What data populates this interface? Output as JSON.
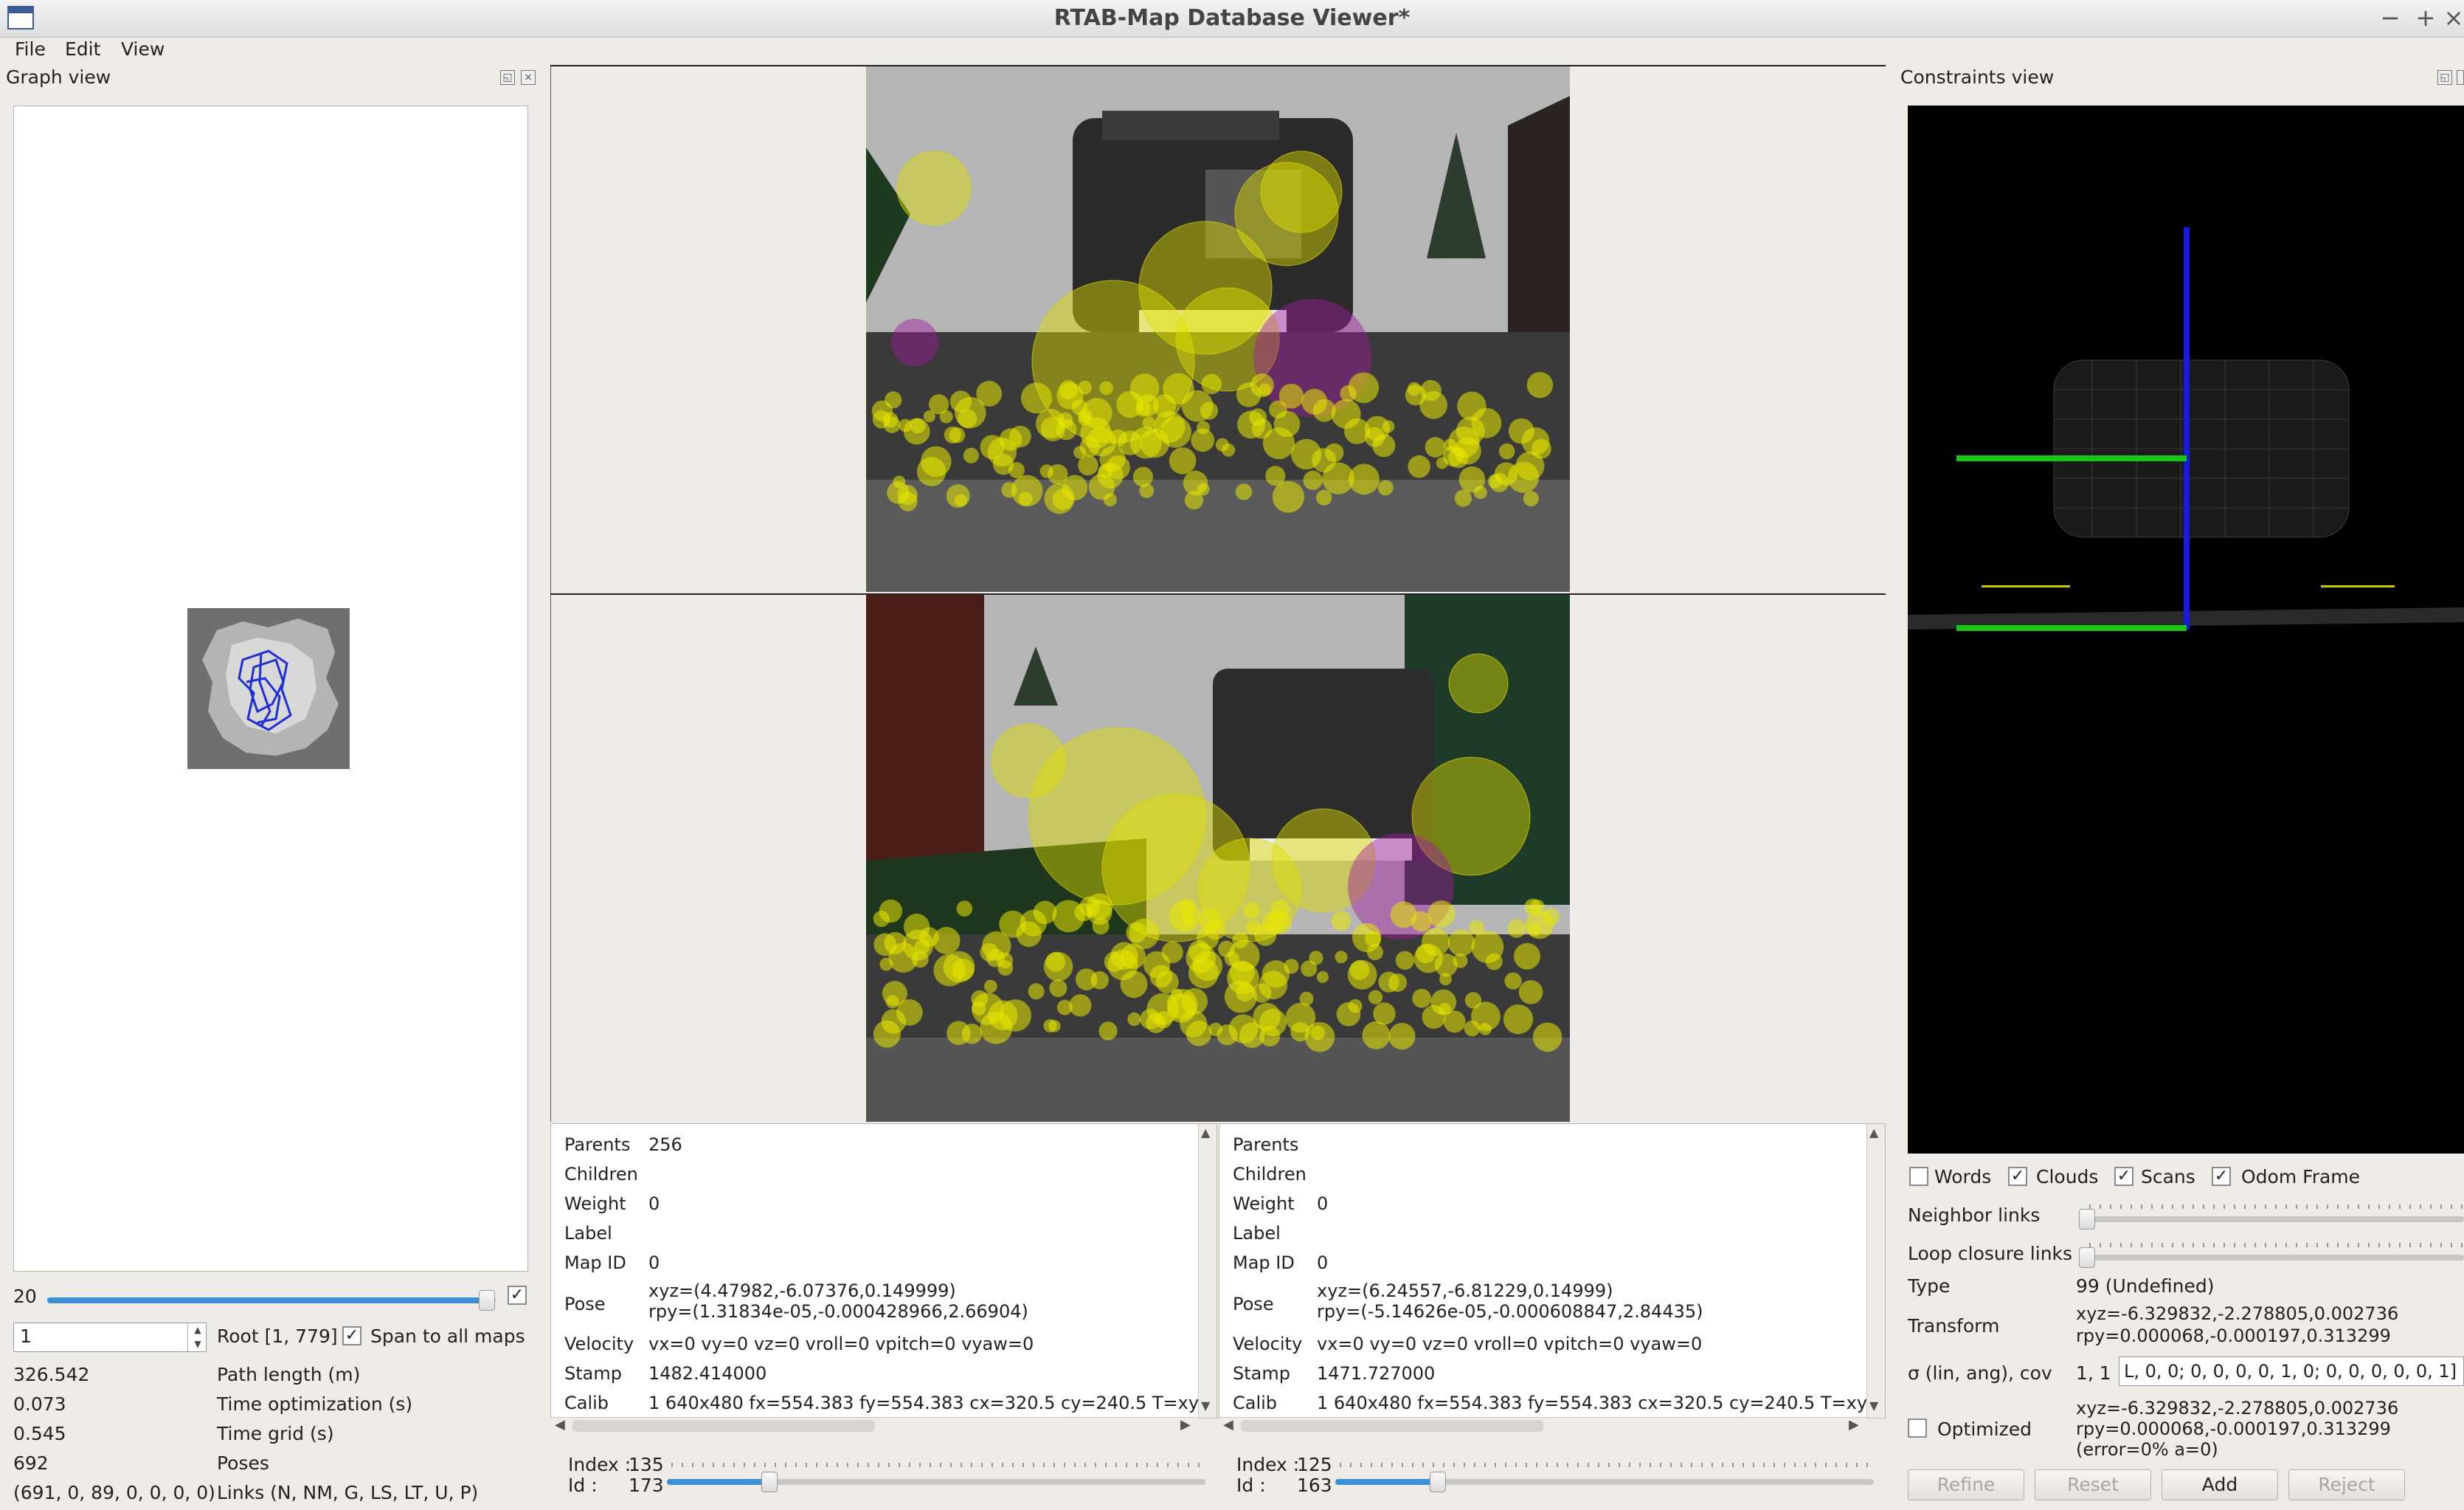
{
  "window": {
    "title": "RTAB-Map Database Viewer*",
    "controls": [
      "−",
      "+",
      "×"
    ]
  },
  "menu": [
    "File",
    "Edit",
    "View"
  ],
  "graph_view": {
    "title": "Graph view",
    "slider_value": "20",
    "slider_fill": 0.98,
    "spin_value": "1",
    "root_label": "Root [1, 779]",
    "span_label": "Span to all maps",
    "span_checked": true,
    "stats": [
      {
        "value": "326.542",
        "label": "Path length (m)"
      },
      {
        "value": "0.073",
        "label": "Time optimization (s)"
      },
      {
        "value": "0.545",
        "label": "Time grid (s)"
      },
      {
        "value": "692",
        "label": "Poses"
      },
      {
        "value": "(691, 0, 89, 0, 0, 0, 0)",
        "label": "Links (N, NM, G, LS, LT, U, P)"
      }
    ]
  },
  "node_a": {
    "parents": "256",
    "children": "",
    "weight": "0",
    "label": "",
    "map_id": "0",
    "pose_xyz": "xyz=(4.47982,-6.07376,0.149999)",
    "pose_rpy": "rpy=(1.31834e-05,-0.000428966,2.66904)",
    "velocity": "vx=0 vy=0 vz=0 vroll=0 vpitch=0 vyaw=0",
    "stamp": "1482.414000",
    "calib": "1 640x480 fx=554.383 fy=554.383 cx=320.5 cy=240.5 T=xy",
    "index": "135",
    "id": "173",
    "slider_fill": 0.19
  },
  "node_b": {
    "parents": "",
    "children": "",
    "weight": "0",
    "label": "",
    "map_id": "0",
    "pose_xyz": "xyz=(6.24557,-6.81229,0.14999)",
    "pose_rpy": "rpy=(-5.14626e-05,-0.000608847,2.84435)",
    "velocity": "vx=0 vy=0 vz=0 vroll=0 vpitch=0 vyaw=0",
    "stamp": "1471.727000",
    "calib": "1 640x480 fx=554.383 fy=554.383 cx=320.5 cy=240.5 T=xy",
    "index": "125",
    "id": "163",
    "slider_fill": 0.19
  },
  "field_labels": {
    "parents": "Parents",
    "children": "Children",
    "weight": "Weight",
    "label": "Label",
    "map_id": "Map ID",
    "pose": "Pose",
    "velocity": "Velocity",
    "stamp": "Stamp",
    "calib": "Calib",
    "index": "Index :",
    "id": "Id :"
  },
  "constraints_view": {
    "title": "Constraints view",
    "checks": [
      {
        "label": "Words",
        "checked": false
      },
      {
        "label": "Clouds",
        "checked": true
      },
      {
        "label": "Scans",
        "checked": true
      },
      {
        "label": "Odom Frame",
        "checked": true
      }
    ],
    "neighbor_links_label": "Neighbor links",
    "loop_closure_links_label": "Loop closure links",
    "type_label": "Type",
    "type_value": "99 (Undefined)",
    "transform_label": "Transform",
    "transform_xyz": "xyz=-6.329832,-2.278805,0.002736",
    "transform_rpy": "rpy=0.000068,-0.000197,0.313299",
    "sigma_label": "σ (lin, ang), cov",
    "sigma_value": "1, 1",
    "cov_value": "L, 0, 0;  0, 0, 0, 0, 1, 0;  0, 0, 0, 0, 0, 1]",
    "optimized_label": "Optimized",
    "optimized_checked": false,
    "optimized_xyz": "xyz=-6.329832,-2.278805,0.002736",
    "optimized_rpy": "rpy=0.000068,-0.000197,0.313299",
    "optimized_error": "(error=0% a=0)",
    "buttons": {
      "refine": "Refine",
      "reset": "Reset",
      "add": "Add",
      "reject": "Reject"
    }
  }
}
